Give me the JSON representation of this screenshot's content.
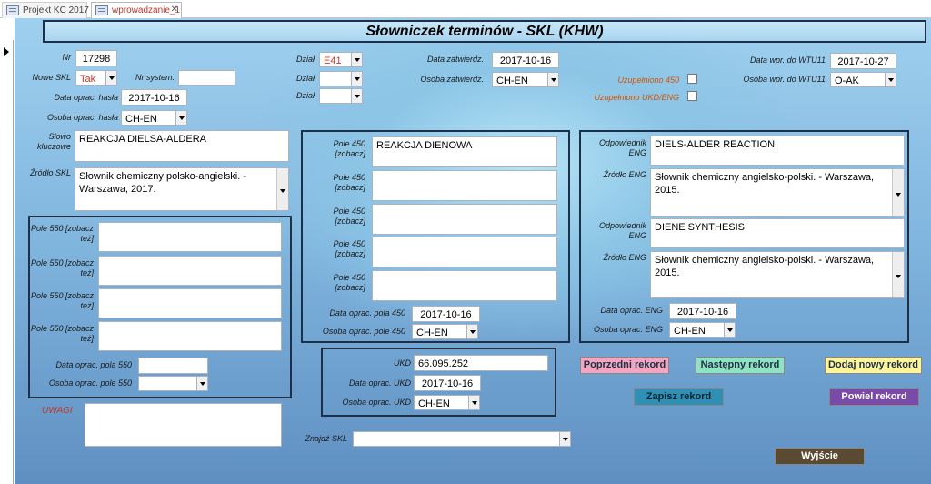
{
  "tabs": [
    {
      "label": "Projekt KC 2017"
    },
    {
      "label": "wprowadzanie_1"
    }
  ],
  "title": "Słowniczek terminów - SKL (KHW)",
  "header": {
    "nr_label": "Nr",
    "nr_value": "17298",
    "nowe_skl_label": "Nowe SKL",
    "nowe_skl_value": "Tak",
    "nr_system_label": "Nr system.",
    "nr_system_value": "",
    "data_opr_hasla_label": "Data oprac. hasła",
    "data_opr_hasla_value": "2017-10-16",
    "osoba_opr_hasla_label": "Osoba oprac. hasła",
    "osoba_opr_hasla_value": "CH-EN",
    "dzial_label": "Dział",
    "dzial_values": [
      "E41",
      "",
      ""
    ],
    "data_zatw_label": "Data zatwierdz.",
    "data_zatw_value": "2017-10-16",
    "osoba_zatw_label": "Osoba zatwierdz.",
    "osoba_zatw_value": "CH-EN",
    "uzup_450_label": "Uzupełniono 450",
    "uzup_ukd_label": "Uzupełniono UKD/ENG",
    "data_wtu_label": "Data wpr. do WTU11",
    "data_wtu_value": "2017-10-27",
    "osoba_wtu_label": "Osoba wpr. do WTU11",
    "osoba_wtu_value": "O-AK"
  },
  "left": {
    "slowo_label": "Słowo kluczowe",
    "slowo_value": "REAKCJA DIELSA-ALDERA",
    "zrodlo_label": "Źródło SKL",
    "zrodlo_value": "Słownik chemiczny polsko-angielski. - Warszawa, 2017.",
    "pole550_label": "Pole 550 [zobacz też]",
    "pole550_values": [
      "",
      "",
      "",
      ""
    ],
    "data_550_label": "Data oprac. pola 550",
    "data_550_value": "",
    "osoba_550_label": "Osoba oprac. pole 550",
    "osoba_550_value": "",
    "uwagi_label": "UWAGI",
    "uwagi_value": ""
  },
  "mid": {
    "pole450_label": "Pole 450 [zobacz]",
    "pole450_values": [
      "REAKCJA DIENOWA",
      "",
      "",
      "",
      ""
    ],
    "data_450_label": "Data oprac. pola 450",
    "data_450_value": "2017-10-16",
    "osoba_450_label": "Osoba oprac. pole 450",
    "osoba_450_value": "CH-EN",
    "ukd_label": "UKD",
    "ukd_value": "66.095.252",
    "data_ukd_label": "Data oprac. UKD",
    "data_ukd_value": "2017-10-16",
    "osoba_ukd_label": "Osoba oprac. UKD",
    "osoba_ukd_value": "CH-EN",
    "znajdz_label": "Znajdź SKL",
    "znajdz_value": ""
  },
  "right": {
    "odp_label": "Odpowiednik ENG",
    "odp1_value": "DIELS-ALDER REACTION",
    "zrodlo_eng_label": "Źródło ENG",
    "zrodlo1_value": "Słownik chemiczny angielsko-polski. - Warszawa, 2015.",
    "odp2_value": "DIENE SYNTHESIS",
    "zrodlo2_value": "Słownik chemiczny angielsko-polski. - Warszawa, 2015.",
    "data_eng_label": "Data oprac. ENG",
    "data_eng_value": "2017-10-16",
    "osoba_eng_label": "Osoba oprac. ENG",
    "osoba_eng_value": "CH-EN"
  },
  "buttons": {
    "prev": "Poprzedni rekord",
    "next": "Następny rekord",
    "add": "Dodaj nowy rekord",
    "save": "Zapisz rekord",
    "dup": "Powiel rekord",
    "exit": "Wyjście"
  },
  "colors": {
    "prev": "#f4a6c0",
    "next": "#8fe3c0",
    "add": "#fff59a",
    "save": "#2f8fb5",
    "dup": "#7a4aa8",
    "exit": "#5a4a33"
  }
}
